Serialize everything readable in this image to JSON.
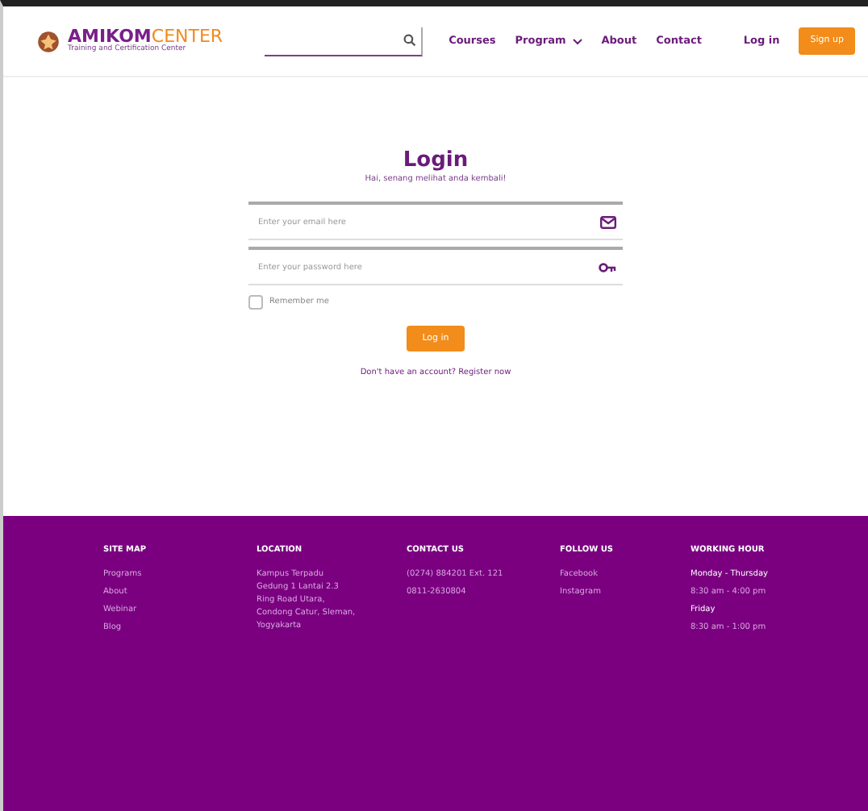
{
  "header": {
    "logo": {
      "brand_bold": "AMIKOM",
      "brand_light": "CENTER",
      "tagline": "Training and Certification Center"
    },
    "nav": [
      {
        "label": "Courses",
        "dropdown": false
      },
      {
        "label": "Program",
        "dropdown": true
      },
      {
        "label": "About",
        "dropdown": false
      },
      {
        "label": "Contact",
        "dropdown": false
      }
    ],
    "login": "Log in",
    "signup": "Sign up"
  },
  "login_form": {
    "title": "Login",
    "subtitle": "Hai, senang melihat anda kembali!",
    "fields": [
      {
        "placeholder": "Enter your email here",
        "kind": "email"
      },
      {
        "placeholder": "Enter your password here",
        "kind": "password"
      }
    ],
    "remember": {
      "label": "Remember me",
      "checked": false
    },
    "button": "Log in",
    "register": "Don't have an account? Register now"
  },
  "footer": {
    "columns": [
      {
        "heading": "SITE MAP",
        "items": [
          {
            "text": "Programs",
            "bold": false
          },
          {
            "text": "About",
            "bold": false
          },
          {
            "text": "Webinar",
            "bold": false
          },
          {
            "text": "Blog",
            "bold": false
          }
        ]
      },
      {
        "heading": "LOCATION",
        "items": [
          {
            "text": "Kampus Terpadu Gedung 1 Lantai 2.3 Ring Road Utara, Condong Catur, Sleman, Yogyakarta",
            "bold": false
          }
        ]
      },
      {
        "heading": "CONTACT US",
        "items": [
          {
            "text": "(0274) 884201 Ext. 121",
            "bold": false
          },
          {
            "text": "0811-2630804",
            "bold": false
          }
        ]
      },
      {
        "heading": "FOLLOW US",
        "items": [
          {
            "text": "Facebook",
            "bold": false
          },
          {
            "text": "Instagram",
            "bold": false
          }
        ]
      },
      {
        "heading": "WORKING HOUR",
        "items": [
          {
            "text": "Monday - Thursday",
            "bold": true
          },
          {
            "text": "8:30 am - 4:00 pm",
            "bold": false
          },
          {
            "text": "Friday",
            "bold": true
          },
          {
            "text": "8:30 am - 1:00 pm",
            "bold": false
          }
        ]
      }
    ]
  }
}
